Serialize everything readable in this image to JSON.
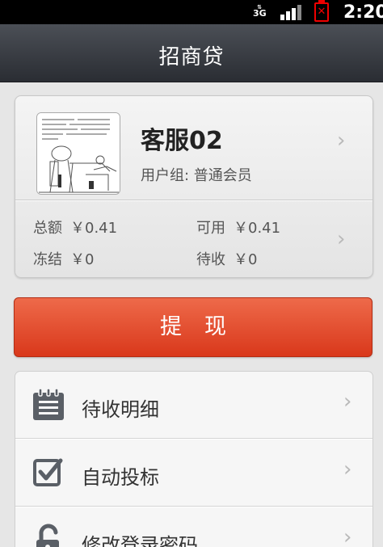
{
  "status_bar": {
    "network": "3G",
    "time": "2:20"
  },
  "header": {
    "title": "招商贷"
  },
  "account": {
    "username": "客服02",
    "user_group": "用户组: 普通会员",
    "stats": {
      "total_label": "总额",
      "total_value": "￥0.41",
      "available_label": "可用",
      "available_value": "￥0.41",
      "frozen_label": "冻结",
      "frozen_value": "￥0",
      "pending_label": "待收",
      "pending_value": "￥0"
    }
  },
  "actions": {
    "withdraw_label": "提现"
  },
  "menu": {
    "items": [
      {
        "label": "待收明细",
        "icon": "calendar-list-icon"
      },
      {
        "label": "自动投标",
        "icon": "checkbox-icon"
      },
      {
        "label": "修改登录密码",
        "icon": "unlock-icon"
      }
    ]
  },
  "colors": {
    "accent": "#e04a2a",
    "title_bar": "#35393f",
    "icon": "#5a5f66"
  }
}
